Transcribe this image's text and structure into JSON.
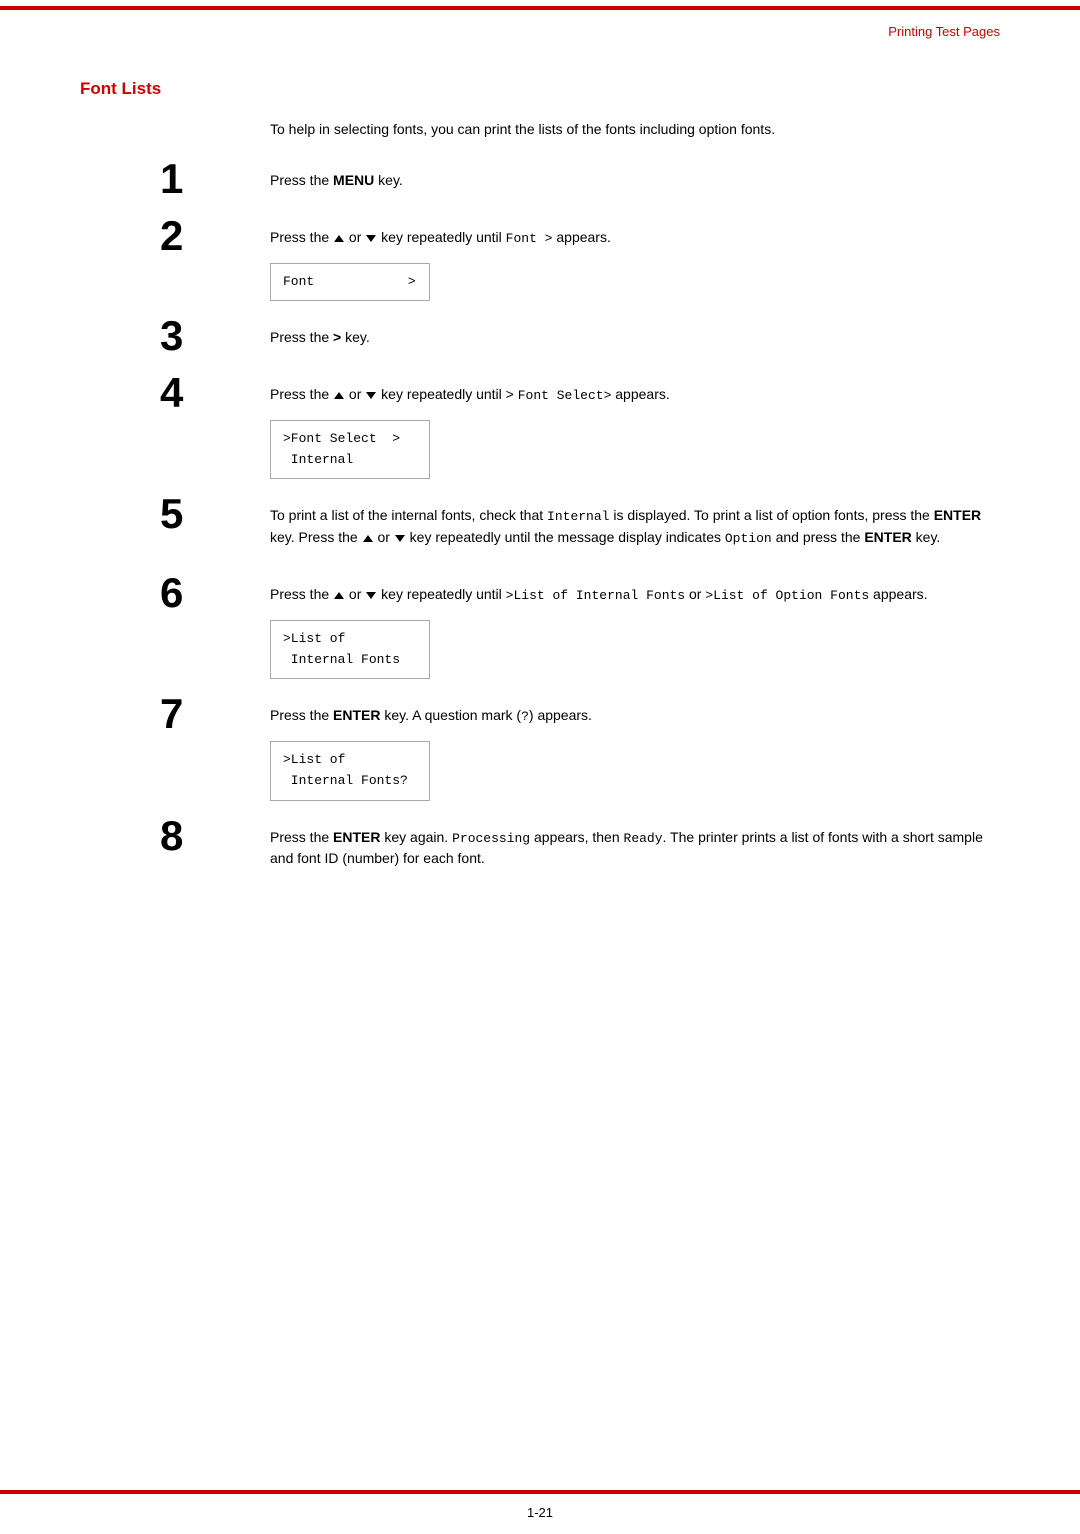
{
  "page": {
    "top_border_color": "#cc0000",
    "header": {
      "right_text": "Printing Test Pages"
    },
    "footer": {
      "page_number": "1-21"
    }
  },
  "section": {
    "title": "Font Lists",
    "intro": "To help in selecting fonts, you can print the lists of the fonts including option fonts."
  },
  "steps": [
    {
      "number": "1",
      "text_before": "Press the ",
      "bold": "MENU",
      "text_after": " key.",
      "has_code_box": false
    },
    {
      "number": "2",
      "text_before": "Press the ∧ or ∨ key repeatedly until ",
      "inline_code": "Font >",
      "text_after": " appears.",
      "has_code_box": true,
      "code_lines": [
        "Font            >"
      ]
    },
    {
      "number": "3",
      "text_before": "Press the ",
      "bold": ">",
      "text_after": " key.",
      "has_code_box": false
    },
    {
      "number": "4",
      "text_before": "Press the ∧ or ∨ key repeatedly until > ",
      "inline_code": "Font Select>",
      "text_after": " appears.",
      "has_code_box": true,
      "code_lines": [
        ">Font Select  >",
        " Internal"
      ]
    },
    {
      "number": "5",
      "text": "To print a list of the internal fonts, check that Internal is displayed. To print a list of option fonts, press the ENTER key. Press the ∧ or ∨ key repeatedly until the message display indicates Option and press the ENTER key.",
      "has_code_box": false
    },
    {
      "number": "6",
      "text_before": "Press the ∧ or ∨ key repeatedly until ",
      "inline_code": ">List of Internal Fonts",
      "text_middle": " or ",
      "inline_code2": ">List of Option Fonts",
      "text_after": " appears.",
      "has_code_box": true,
      "code_lines": [
        ">List of",
        " Internal Fonts"
      ]
    },
    {
      "number": "7",
      "text_before": "Press the ",
      "bold": "ENTER",
      "text_after": " key. A question mark (",
      "inline_code": "?",
      "text_after2": ") appears.",
      "has_code_box": true,
      "code_lines": [
        ">List of",
        " Internal Fonts?"
      ]
    },
    {
      "number": "8",
      "text": "Press the ENTER key again. Processing appears, then Ready. The printer prints a list of fonts with a short sample and font ID (number) for each font.",
      "has_code_box": false
    }
  ]
}
